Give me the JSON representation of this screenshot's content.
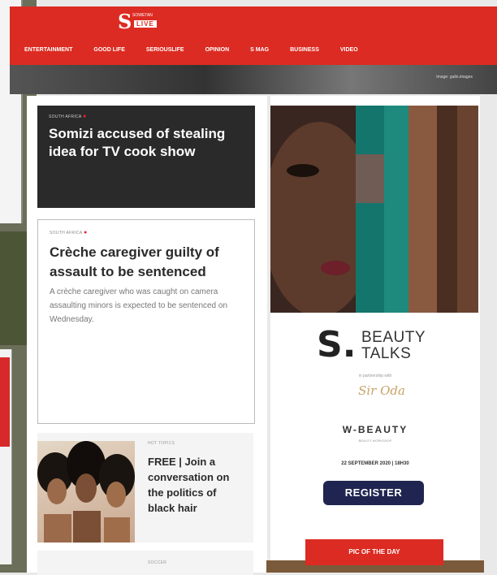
{
  "header": {
    "logo_main": "S",
    "logo_small": "SOWETAN",
    "logo_box": "LIVE",
    "nav": [
      "ENTERTAINMENT",
      "GOOD LIFE",
      "SERIOUSLIFE",
      "OPINION",
      "S MAG",
      "BUSINESS",
      "VIDEO"
    ],
    "strip_credit": "Image: gallo.images"
  },
  "articles": [
    {
      "tag": "SOUTH AFRICA",
      "title": "Somizi accused of stealing idea for TV cook show"
    },
    {
      "tag": "SOUTH AFRICA",
      "title": "Crèche caregiver guilty of assault to be sentenced",
      "summary": "A crèche caregiver who was caught on camera assaulting minors is expected to be sentenced on Wednesday."
    },
    {
      "tag": "HOT TOPICS",
      "title": "FREE | Join a conversation on the politics of black hair"
    },
    {
      "tag": "SOCCER"
    }
  ],
  "ad": {
    "logo_mark": "S.",
    "logo_line1": "BEAUTY",
    "logo_line2": "TALKS",
    "partner_text": "in partnership with",
    "signature": "Sir Oda",
    "sponsor": "W-BEAUTY",
    "sponsor_sub": "BEAUTY WORKSHOP",
    "date": "22 SEPTEMBER 2020 | 18H30",
    "register_label": "REGISTER"
  },
  "pic_of_the_day": "PIC OF THE DAY",
  "colors": {
    "brand_red": "#dc2b22",
    "dark_card": "#2a2a2a",
    "register_navy": "#1f2550"
  }
}
